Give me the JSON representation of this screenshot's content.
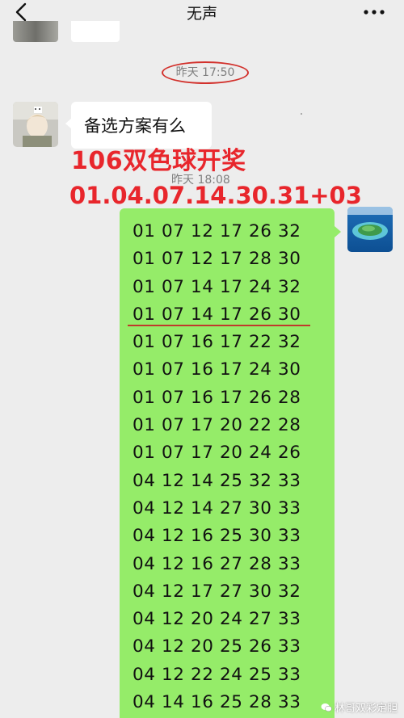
{
  "nav": {
    "title": "无声"
  },
  "timestamps": {
    "first": "昨天 17:50",
    "second": "昨天 18:08"
  },
  "messages": {
    "left_text": "备选方案有么"
  },
  "overlay": {
    "title": "106双色球开奖",
    "numbers": "01.04.07.14.30.31+03",
    "color": "#e8262c"
  },
  "number_rows": [
    "01 07 12 17 26 32",
    "01 07 12 17 28 30",
    "01 07 14 17 24 32",
    "01 07 14 17 26 30",
    "01 07 16 17 22 32",
    "01 07 16 17 24 30",
    "01 07 16 17 26 28",
    "01 07 17 20 22 28",
    "01 07 17 20 24 26",
    "04 12 14 25 32 33",
    "04 12 14 27 30 33",
    "04 12 16 25 30 33",
    "04 12 16 27 28 33",
    "04 12 17 27 30 32",
    "04 12 20 24 27 33",
    "04 12 20 25 26 33",
    "04 12 22 24 25 33",
    "04 14 16 25 28 33"
  ],
  "watermark": {
    "text": "林哥双彩定胆"
  },
  "colors": {
    "background": "#ededed",
    "bubble_green": "#95ec69",
    "highlight_red": "#d2312c"
  },
  "icons": {
    "back": "chevron-left-icon",
    "more": "ellipsis-icon",
    "watermark": "wechat-icon"
  }
}
